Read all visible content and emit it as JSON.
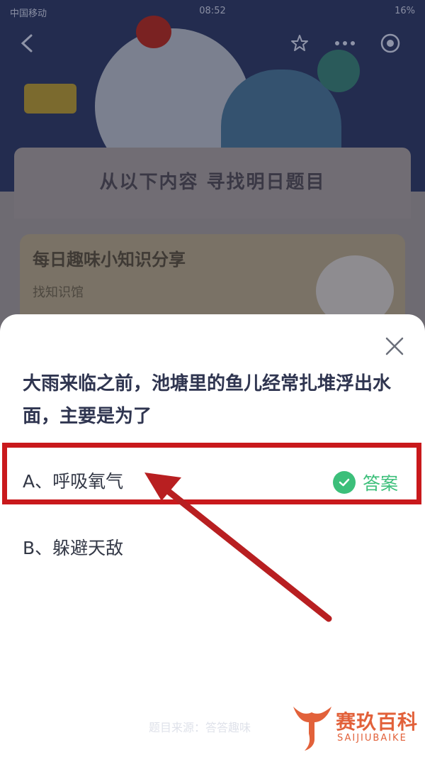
{
  "status_bar": {
    "carrier": "中国移动",
    "time": "08:52",
    "battery": "16%"
  },
  "background": {
    "panel_title": "从以下内容 寻找明日题目",
    "card_title": "每日趣味小知识分享",
    "card_subtitle": "找知识馆"
  },
  "quiz": {
    "question": "大雨来临之前，池塘里的鱼儿经常扎堆浮出水面，主要是为了",
    "options": [
      {
        "label": "A、呼吸氧气",
        "is_answer": true
      },
      {
        "label": "B、躲避天敌",
        "is_answer": false
      }
    ],
    "answer_label": "答案",
    "footer": "题目来源：答答趣味"
  },
  "watermark": {
    "text": "赛玖百科",
    "sub": "SAIJIUBAIKE"
  },
  "colors": {
    "highlight": "#c9191c",
    "answer_green": "#3cbf7a",
    "arrow": "#b81f21"
  },
  "icons": [
    "back-icon",
    "star-icon",
    "more-icon",
    "target-icon",
    "close-icon",
    "check-icon",
    "arrow-annotation"
  ]
}
